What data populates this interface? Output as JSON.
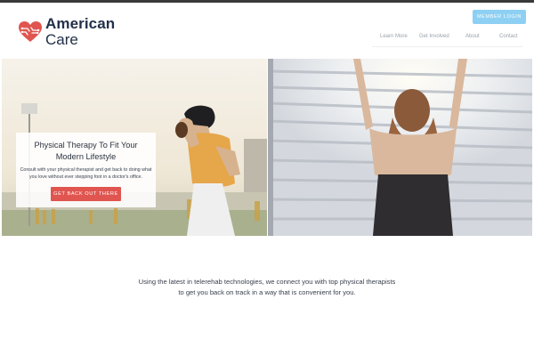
{
  "brand": {
    "line1": "American",
    "line2": "Care",
    "accent": "#e0554f",
    "name_color": "#223049"
  },
  "header": {
    "member_login_label": "MEMBER LOGIN",
    "member_login_color": "#8ed0f3"
  },
  "nav": {
    "items": [
      "Learn More",
      "Get Involved",
      "About",
      "Contact"
    ]
  },
  "hero": {
    "left_image": "football-quarterback-photo",
    "right_image": "woman-athlete-back-photo",
    "card": {
      "title": "Physical Therapy To Fit Your Modern Lifestyle",
      "body": "Consult with your physical therapist and get back to doing what you love without ever stepping foot in a doctor's office.",
      "cta_label": "GET BACK OUT THERE"
    }
  },
  "intro": {
    "line1": "Using the latest in telerehab technologies, we connect you with top physical therapists",
    "line2": "to get you back on track in a way that is convenient for you."
  }
}
